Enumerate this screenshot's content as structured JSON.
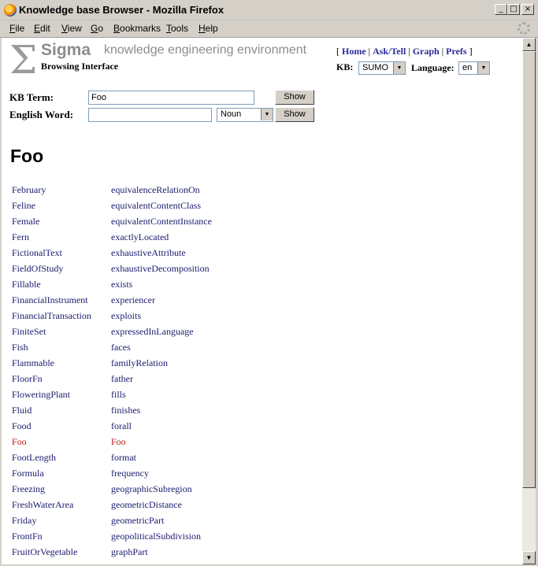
{
  "window": {
    "title": "Knowledge base Browser - Mozilla Firefox",
    "controls": {
      "minimize": "_",
      "maximize": "□",
      "close": "×"
    }
  },
  "menubar": {
    "items": [
      "File",
      "Edit",
      "View",
      "Go",
      "Bookmarks",
      "Tools",
      "Help"
    ]
  },
  "header": {
    "logo_glyph": "Σ",
    "name": "Sigma",
    "tagline": "knowledge engineering environment",
    "subtitle": "Browsing Interface",
    "nav": [
      "Home",
      "Ask/Tell",
      "Graph",
      "Prefs"
    ],
    "kb_label": "KB:",
    "kb_value": "SUMO",
    "language_label": "Language:",
    "language_value": "en"
  },
  "form": {
    "kb_term_label": "KB Term:",
    "kb_term_value": "Foo",
    "english_word_label": "English Word:",
    "english_word_value": "",
    "pos_value": "Noun",
    "show_label": "Show"
  },
  "heading": "Foo",
  "terms": [
    [
      "February",
      "equivalenceRelationOn"
    ],
    [
      "Feline",
      "equivalentContentClass"
    ],
    [
      "Female",
      "equivalentContentInstance"
    ],
    [
      "Fern",
      "exactlyLocated"
    ],
    [
      "FictionalText",
      "exhaustiveAttribute"
    ],
    [
      "FieldOfStudy",
      "exhaustiveDecomposition"
    ],
    [
      "Fillable",
      "exists"
    ],
    [
      "FinancialInstrument",
      "experiencer"
    ],
    [
      "FinancialTransaction",
      "exploits"
    ],
    [
      "FiniteSet",
      "expressedInLanguage"
    ],
    [
      "Fish",
      "faces"
    ],
    [
      "Flammable",
      "familyRelation"
    ],
    [
      "FloorFn",
      "father"
    ],
    [
      "FloweringPlant",
      "fills"
    ],
    [
      "Fluid",
      "finishes"
    ],
    [
      "Food",
      "forall"
    ],
    [
      "Foo",
      "Foo"
    ],
    [
      "FootLength",
      "format"
    ],
    [
      "Formula",
      "frequency"
    ],
    [
      "Freezing",
      "geographicSubregion"
    ],
    [
      "FreshWaterArea",
      "geometricDistance"
    ],
    [
      "Friday",
      "geometricPart"
    ],
    [
      "FrontFn",
      "geopoliticalSubdivision"
    ],
    [
      "FruitOrVegetable",
      "graphPart"
    ]
  ],
  "current_term_index": 16,
  "colors": {
    "link": "#1a1a6e",
    "current": "#c01818",
    "nav_link": "#2a2a9c",
    "logo_gray": "#8c8c8c"
  }
}
